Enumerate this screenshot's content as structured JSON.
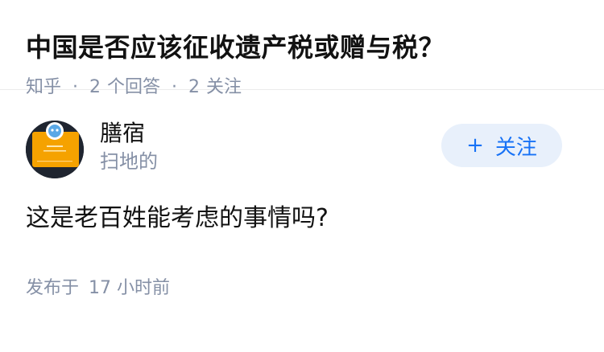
{
  "question": {
    "title": "中国是否应该征收遗产税或赠与税？",
    "source": "知乎",
    "separator": "·",
    "answer_count": "2",
    "answer_label": "个回答",
    "follow_count": "2",
    "follow_label": "关注"
  },
  "answer": {
    "author": {
      "name": "膳宿",
      "bio": "扫地的",
      "avatar": "avatar-icon"
    },
    "follow_button": {
      "plus": "+",
      "label": "关注"
    },
    "content": "这是老百姓能考虑的事情吗?",
    "published_label": "发布于",
    "published_time": "17 小时前"
  },
  "colors": {
    "title": "#121212",
    "meta": "#8590a6",
    "accent": "#1772f6",
    "follow_bg": "#e8f0fb",
    "avatar_orange": "#f5a200"
  }
}
